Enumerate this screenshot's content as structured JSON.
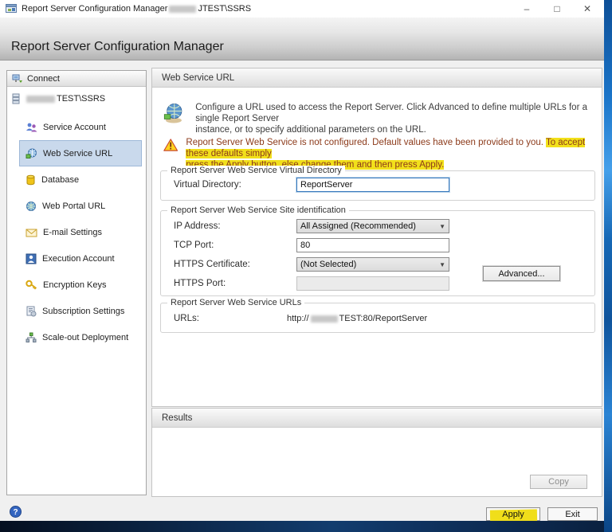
{
  "window": {
    "title_prefix": "Report Server Configuration Manager",
    "title_server_suffix": "JTEST\\SSRS",
    "controls": {
      "minimize": "–",
      "maximize": "□",
      "close": "✕"
    }
  },
  "header": {
    "title": "Report Server Configuration Manager"
  },
  "sidebar": {
    "connect_label": "Connect",
    "server_node": {
      "visible_suffix": "TEST\\SSRS"
    },
    "items": [
      {
        "label": "Service Account",
        "icon": "service-account-icon",
        "selected": false
      },
      {
        "label": "Web Service URL",
        "icon": "web-service-url-icon",
        "selected": true
      },
      {
        "label": "Database",
        "icon": "database-icon",
        "selected": false
      },
      {
        "label": "Web Portal URL",
        "icon": "web-portal-url-icon",
        "selected": false
      },
      {
        "label": "E-mail Settings",
        "icon": "email-settings-icon",
        "selected": false
      },
      {
        "label": "Execution Account",
        "icon": "execution-account-icon",
        "selected": false
      },
      {
        "label": "Encryption Keys",
        "icon": "encryption-keys-icon",
        "selected": false
      },
      {
        "label": "Subscription Settings",
        "icon": "subscription-settings-icon",
        "selected": false
      },
      {
        "label": "Scale-out Deployment",
        "icon": "scale-out-deployment-icon",
        "selected": false
      }
    ]
  },
  "main": {
    "panel_title": "Web Service URL",
    "description": {
      "line1": "Configure a URL used to access the Report Server.  Click Advanced to define multiple URLs for a single Report Server",
      "line2": "instance, or to specify additional parameters on the URL."
    },
    "warning": {
      "line1_plain": "Report Server Web Service is not configured. Default values have been provided to you. ",
      "line1_highlight": "To accept these defaults simply",
      "line2_highlight": "press the Apply button, else change them and then press Apply."
    },
    "groups": {
      "virtual_directory": {
        "title": "Report Server Web Service Virtual Directory",
        "field_label": "Virtual Directory:",
        "field_value": "ReportServer"
      },
      "site_identification": {
        "title": "Report Server Web Service Site identification",
        "ip_address_label": "IP Address:",
        "ip_address_value": "All Assigned (Recommended)",
        "tcp_port_label": "TCP Port:",
        "tcp_port_value": "80",
        "https_certificate_label": "HTTPS Certificate:",
        "https_certificate_value": "(Not Selected)",
        "https_port_label": "HTTPS Port:",
        "https_port_value": "",
        "advanced_button": "Advanced..."
      },
      "urls": {
        "title": "Report Server Web Service URLs",
        "label": "URLs:",
        "url_prefix": "http://",
        "url_visible_suffix": "TEST:80/ReportServer"
      }
    }
  },
  "results": {
    "title": "Results",
    "copy_button": "Copy"
  },
  "footer": {
    "apply_button": "Apply",
    "exit_button": "Exit"
  },
  "colors": {
    "highlight_yellow": "#f2e01a",
    "warning_text": "#8c3a1a",
    "selected_nav_bg": "#c9d9ec",
    "bottom_band_navy": "#0d2c55",
    "focus_border_blue": "#3779bd"
  }
}
